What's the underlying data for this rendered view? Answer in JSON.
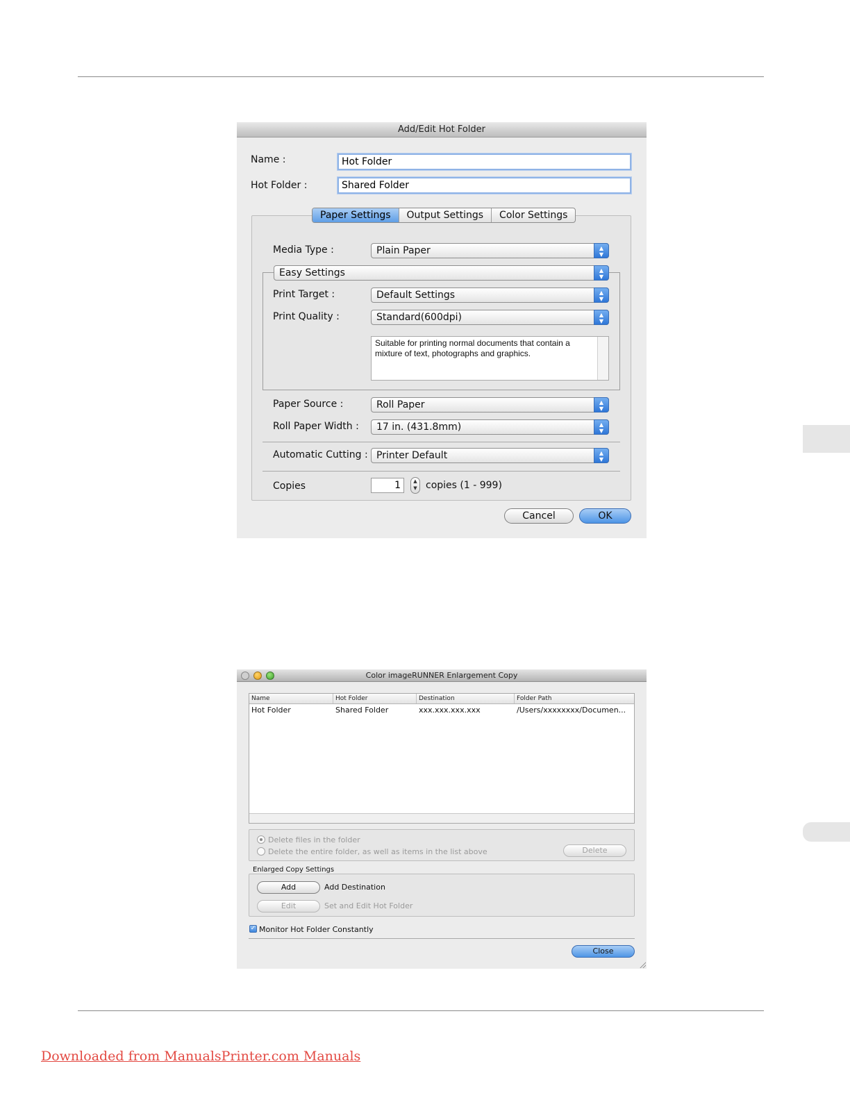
{
  "dialog_edit": {
    "title": "Add/Edit Hot Folder",
    "name_label": "Name :",
    "name_value": "Hot Folder",
    "hot_folder_label": "Hot Folder :",
    "hot_folder_value": "Shared Folder",
    "tabs": [
      {
        "label": "Paper Settings",
        "active": true
      },
      {
        "label": "Output Settings",
        "active": false
      },
      {
        "label": "Color Settings",
        "active": false
      }
    ],
    "media_type_label": "Media Type :",
    "media_type_value": "Plain Paper",
    "mode_value": "Easy Settings",
    "print_target_label": "Print Target :",
    "print_target_value": "Default Settings",
    "print_quality_label": "Print Quality :",
    "print_quality_value": "Standard(600dpi)",
    "description": "Suitable for printing normal documents that contain a mixture of text, photographs and graphics.",
    "paper_source_label": "Paper Source :",
    "paper_source_value": "Roll Paper",
    "roll_width_label": "Roll Paper Width :",
    "roll_width_value": "17 in. (431.8mm)",
    "auto_cut_label": "Automatic Cutting :",
    "auto_cut_value": "Printer Default",
    "copies_label": "Copies",
    "copies_value": "1",
    "copies_range": "copies (1 - 999)",
    "cancel_label": "Cancel",
    "ok_label": "OK"
  },
  "dialog_list": {
    "title": "Color imageRUNNER Enlargement Copy",
    "columns": [
      "Name",
      "Hot Folder",
      "Destination",
      "Folder Path"
    ],
    "rows": [
      [
        "Hot Folder",
        "Shared Folder",
        "xxx.xxx.xxx.xxx",
        "/Users/xxxxxxxx/Documen..."
      ]
    ],
    "delete_files_label": "Delete files in the folder",
    "delete_folder_label": "Delete the entire folder, as well as items in the list above",
    "delete_label": "Delete",
    "section_label": "Enlarged Copy Settings",
    "add_label": "Add",
    "add_desc": "Add Destination",
    "edit_label": "Edit",
    "edit_desc": "Set and Edit Hot Folder",
    "monitor_label": "Monitor Hot Folder Constantly",
    "monitor_checked": true,
    "close_label": "Close"
  },
  "footer": {
    "link_text": "Downloaded from ManualsPrinter.com Manuals"
  },
  "colors": {
    "link": "#e34a43",
    "accent": "#4e95e6"
  }
}
